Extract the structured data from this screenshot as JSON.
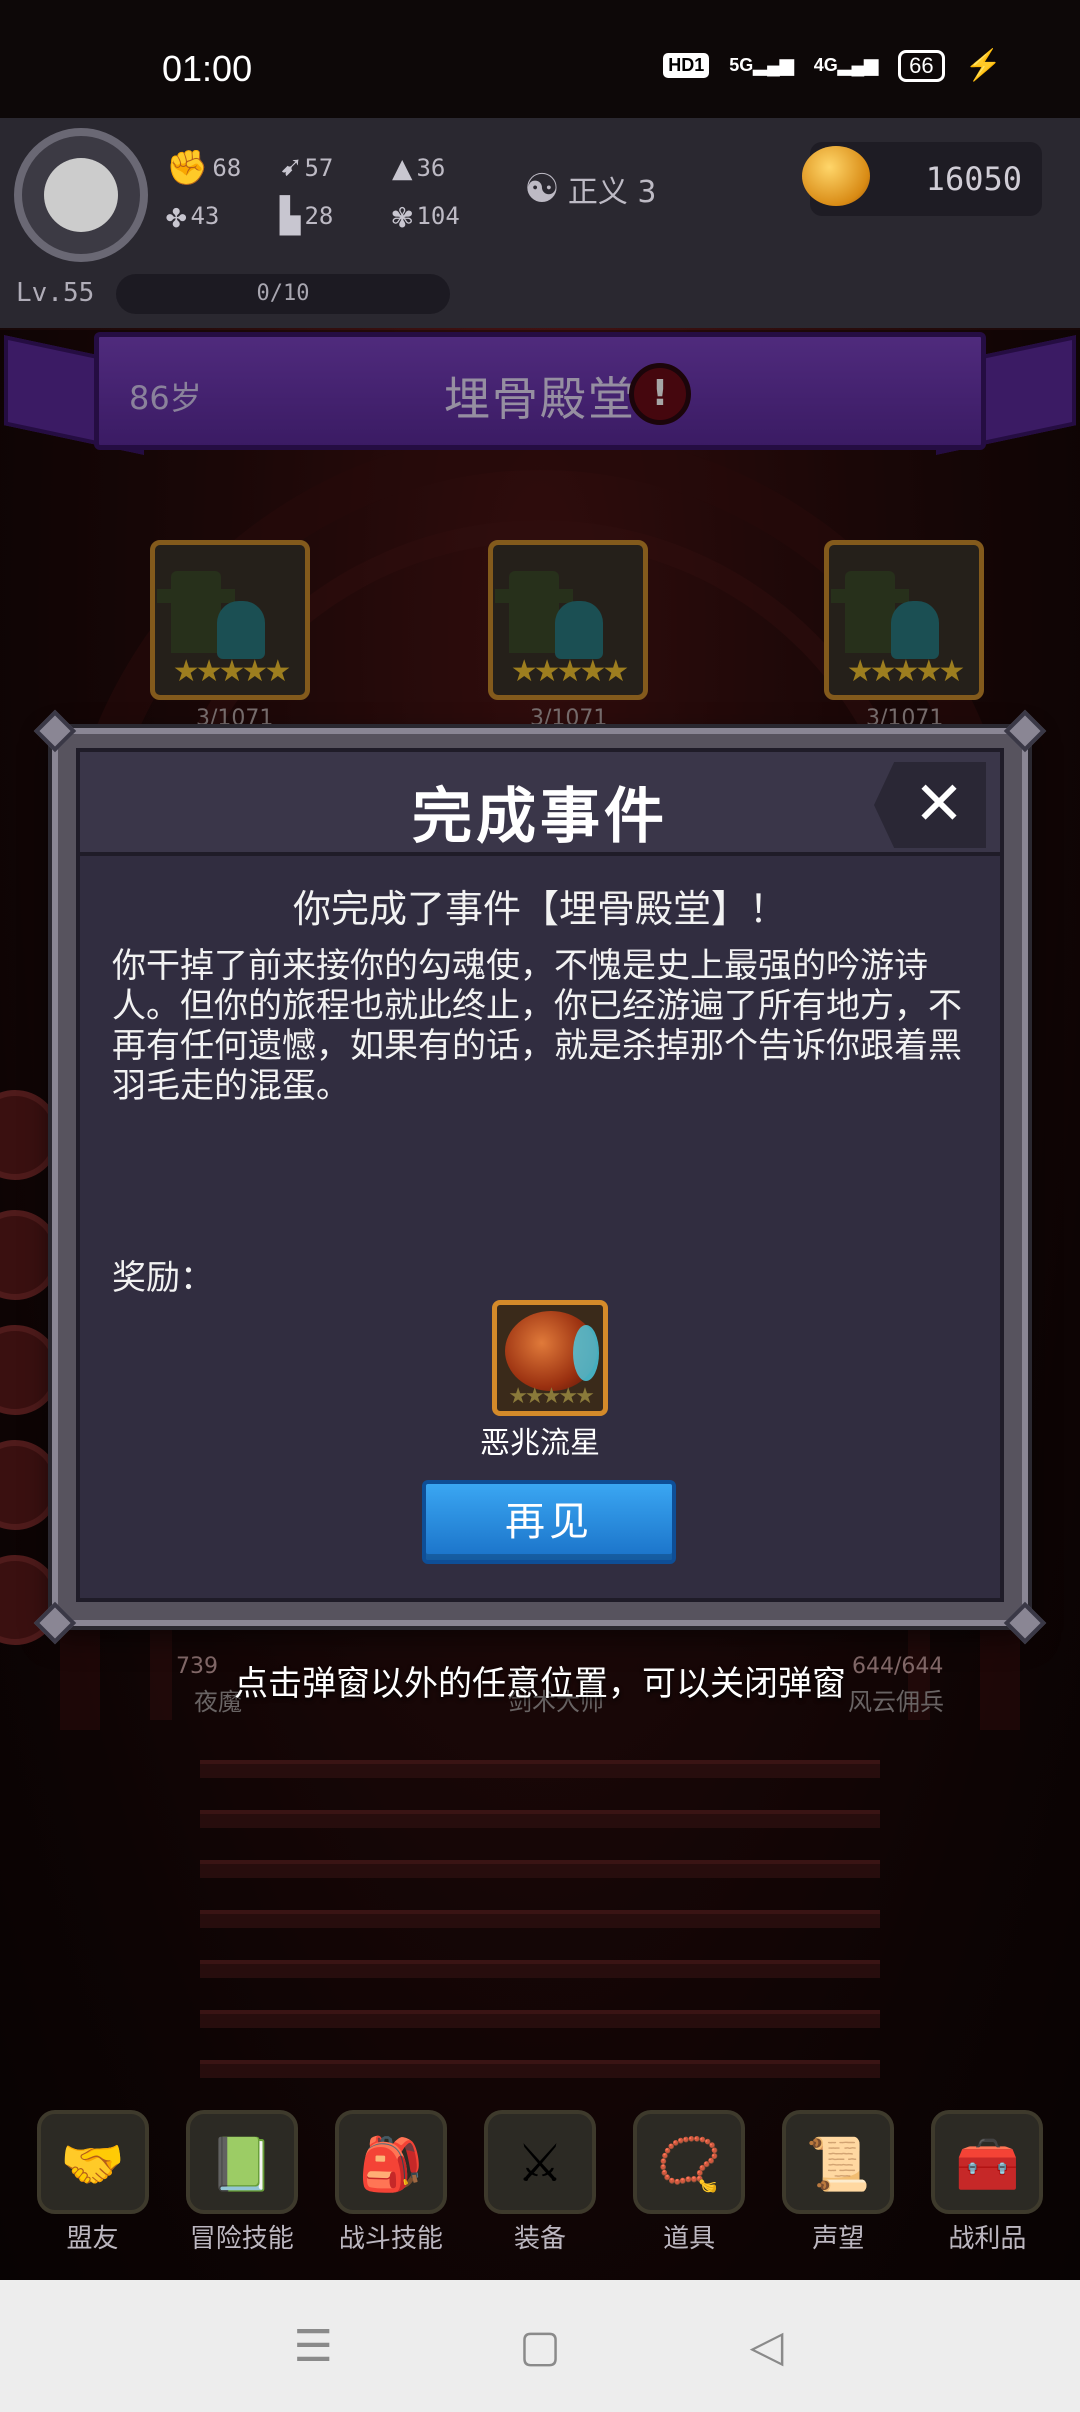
{
  "status_bar": {
    "time": "01:00",
    "hd_tag": "HD1",
    "sig1": "5G",
    "sig2": "4G",
    "battery": "66"
  },
  "player": {
    "stats": [
      {
        "icon": "fist-icon",
        "value": "68"
      },
      {
        "icon": "clover-icon",
        "value": "43"
      },
      {
        "icon": "boot-icon",
        "value": "57"
      },
      {
        "icon": "armor-icon",
        "value": "28"
      },
      {
        "icon": "wizard-hat-icon",
        "value": "36"
      },
      {
        "icon": "plant-icon",
        "value": "104"
      }
    ],
    "justice": "正义 3",
    "gold": "16050",
    "level": "Lv.55",
    "xp": "0/10"
  },
  "location": {
    "age": "86岁",
    "title": "埋骨殿堂"
  },
  "enemies": [
    {
      "stars": "★★★★★",
      "meta": "3/1071"
    },
    {
      "stars": "★★★★★",
      "meta": "3/1071"
    },
    {
      "stars": "★★★★★",
      "meta": "3/1071"
    }
  ],
  "modal": {
    "title": "完成事件",
    "subtitle": "你完成了事件【埋骨殿堂】！",
    "body": "你干掉了前来接你的勾魂使，不愧是史上最强的吟游诗人。但你的旅程也就此终止，你已经游遍了所有地方，不再有任何遗憾，如果有的话，就是杀掉那个告诉你跟着黑羽毛走的混蛋。",
    "reward_label": "奖励：",
    "reward_name": "恶兆流星",
    "button": "再见"
  },
  "hint": "点击弹窗以外的任意位置，可以关闭弹窗",
  "behind": {
    "left_hp": "739",
    "left_name": "夜魔",
    "mid_name": "剑术大师",
    "right_hp": "644/644",
    "right_name": "风云佣兵"
  },
  "bottom_nav": [
    {
      "label": "盟友",
      "icon": "handshake-icon",
      "glyph": "🤝"
    },
    {
      "label": "冒险技能",
      "icon": "book-icon",
      "glyph": "📗"
    },
    {
      "label": "战斗技能",
      "icon": "backpack-icon",
      "glyph": "🎒"
    },
    {
      "label": "装备",
      "icon": "swords-icon",
      "glyph": "⚔"
    },
    {
      "label": "道具",
      "icon": "amulet-icon",
      "glyph": "📿"
    },
    {
      "label": "声望",
      "icon": "scroll-icon",
      "glyph": "📜"
    },
    {
      "label": "战利品",
      "icon": "chest-icon",
      "glyph": "🧰"
    }
  ]
}
